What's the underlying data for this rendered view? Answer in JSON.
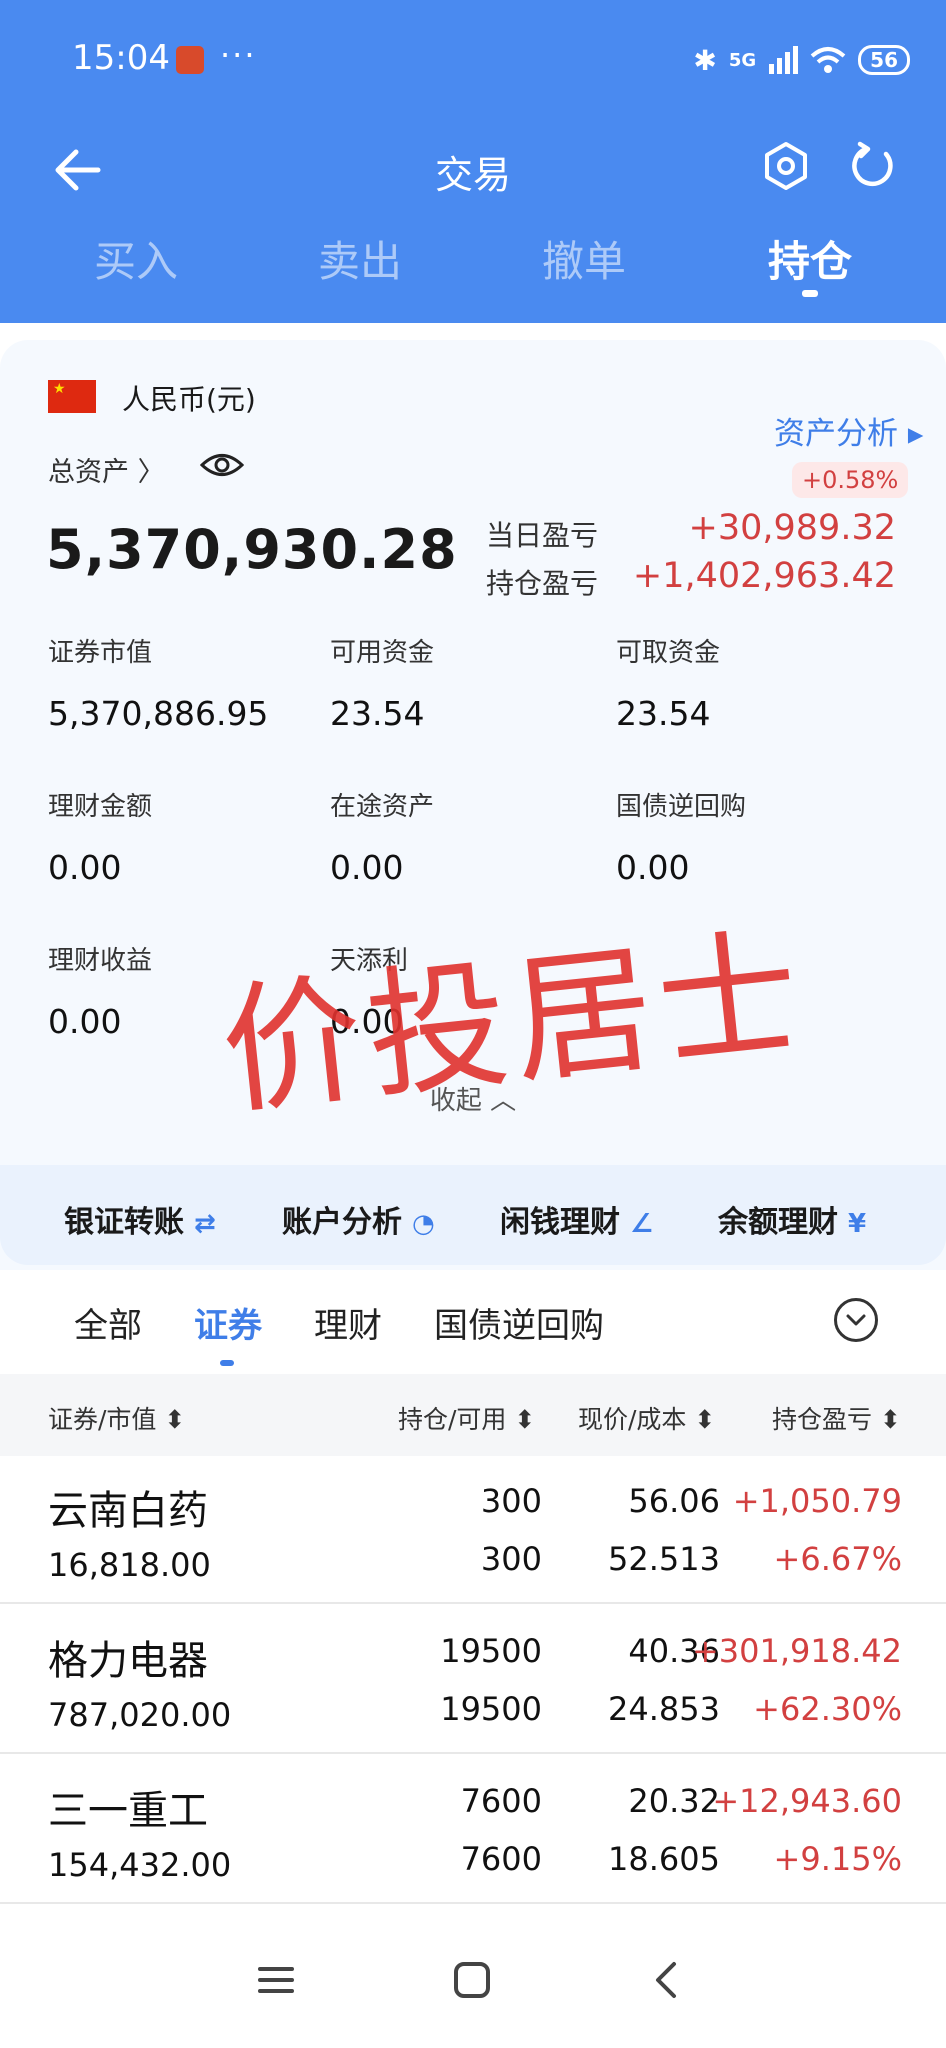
{
  "status_bar": {
    "time": "15:04",
    "more": "···",
    "network": "5G",
    "battery": "56"
  },
  "nav": {
    "title": "交易"
  },
  "top_tabs": [
    {
      "label": "买入"
    },
    {
      "label": "卖出"
    },
    {
      "label": "撤单"
    },
    {
      "label": "持仓"
    }
  ],
  "asset": {
    "currency": "人民币(元)",
    "analysis_link": "资产分析 ▸",
    "total_label": "总资产 〉",
    "total_value": "5,370,930.28",
    "daily_pct": "+0.58%",
    "daily_pl_label": "当日盈亏",
    "daily_pl_value": "+30,989.32",
    "position_pl_label": "持仓盈亏",
    "position_pl_value": "+1,402,963.42",
    "grid": [
      {
        "label": "证券市值",
        "value": "5,370,886.95"
      },
      {
        "label": "可用资金",
        "value": "23.54"
      },
      {
        "label": "可取资金",
        "value": "23.54"
      },
      {
        "label": "理财金额",
        "value": "0.00"
      },
      {
        "label": "在途资产",
        "value": "0.00"
      },
      {
        "label": "国债逆回购",
        "value": "0.00"
      },
      {
        "label": "理财收益",
        "value": "0.00"
      },
      {
        "label": "天添利",
        "value": "0.00"
      }
    ],
    "collapse_label": "收起 ︿",
    "watermark": "价投居士"
  },
  "quick_actions": [
    {
      "label": "银证转账",
      "icon": "⇄"
    },
    {
      "label": "账户分析",
      "icon": "◔"
    },
    {
      "label": "闲钱理财",
      "icon": "∠"
    },
    {
      "label": "余额理财",
      "icon": "¥"
    }
  ],
  "filter_tabs": [
    {
      "label": "全部"
    },
    {
      "label": "证券"
    },
    {
      "label": "理财"
    },
    {
      "label": "国债逆回购"
    }
  ],
  "table": {
    "headers": [
      "证券/市值 ⬍",
      "持仓/可用 ⬍",
      "现价/成本 ⬍",
      "持仓盈亏 ⬍"
    ],
    "rows": [
      {
        "name": "云南白药",
        "market_value": "16,818.00",
        "holding": "300",
        "available": "300",
        "price": "56.06",
        "cost": "52.513",
        "pl": "+1,050.79",
        "pl_pct": "+6.67%"
      },
      {
        "name": "格力电器",
        "market_value": "787,020.00",
        "holding": "19500",
        "available": "19500",
        "price": "40.36",
        "cost": "24.853",
        "pl": "+301,918.42",
        "pl_pct": "+62.30%"
      },
      {
        "name": "三一重工",
        "market_value": "154,432.00",
        "holding": "7600",
        "available": "7600",
        "price": "20.32",
        "cost": "18.605",
        "pl": "+12,943.60",
        "pl_pct": "+9.15%"
      }
    ]
  },
  "colors": {
    "header_blue": "#4a8af0",
    "accent_blue": "#3f7ee8",
    "profit_red": "#d24040"
  }
}
